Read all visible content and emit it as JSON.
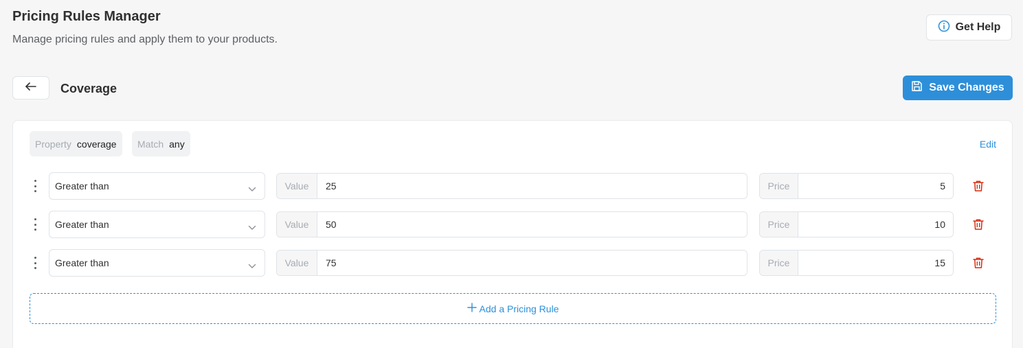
{
  "header": {
    "title": "Pricing Rules Manager",
    "subtitle": "Manage pricing rules and apply them to your products.",
    "help_label": "Get Help"
  },
  "section": {
    "title": "Coverage",
    "save_label": "Save Changes"
  },
  "filters": {
    "property_key": "Property",
    "property_value": "coverage",
    "match_key": "Match",
    "match_value": "any",
    "edit_label": "Edit"
  },
  "rules": [
    {
      "operator": "Greater than",
      "value_label": "Value",
      "value": "25",
      "price_label": "Price",
      "price": "5"
    },
    {
      "operator": "Greater than",
      "value_label": "Value",
      "value": "50",
      "price_label": "Price",
      "price": "10"
    },
    {
      "operator": "Greater than",
      "value_label": "Value",
      "value": "75",
      "price_label": "Price",
      "price": "15"
    }
  ],
  "add_rule_label": "Add a Pricing Rule",
  "colors": {
    "accent": "#2d8fd9",
    "danger": "#d72c0d",
    "background": "#f6f6f7"
  },
  "icons": {
    "help": "info-circle-icon",
    "back": "arrow-left-icon",
    "save": "floppy-disk-icon",
    "drag": "drag-handle-icon",
    "chevron": "chevron-down-icon",
    "delete": "trash-icon",
    "add": "plus-icon"
  }
}
